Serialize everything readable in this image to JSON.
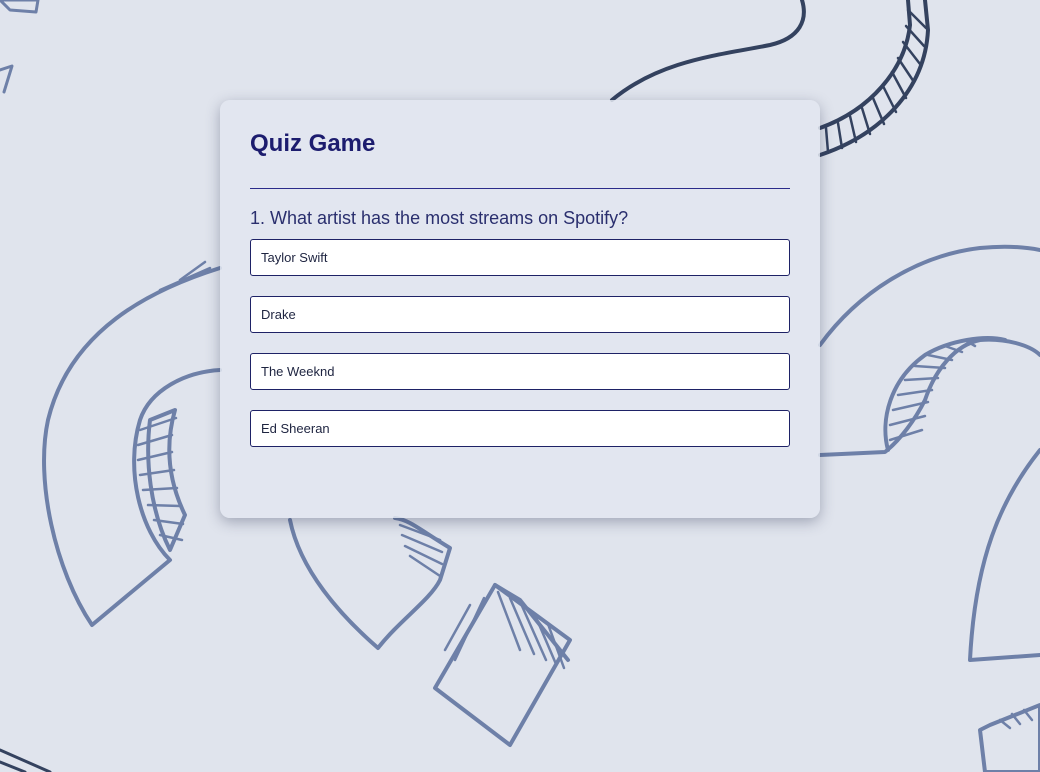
{
  "quiz": {
    "title": "Quiz Game",
    "question": "1. What artist has the most streams on Spotify?",
    "options": [
      {
        "label": "Taylor Swift"
      },
      {
        "label": "Drake"
      },
      {
        "label": "The Weeknd"
      },
      {
        "label": "Ed Sheeran"
      }
    ]
  },
  "theme": {
    "background": "#e0e4ed",
    "title_color": "#1c1c6e",
    "accent_border": "#1e2266",
    "doodle_stroke": "#6e80a8",
    "doodle_stroke_dark": "#34425f"
  },
  "background_art": {
    "icon": "question-mark-doodle-icon"
  }
}
